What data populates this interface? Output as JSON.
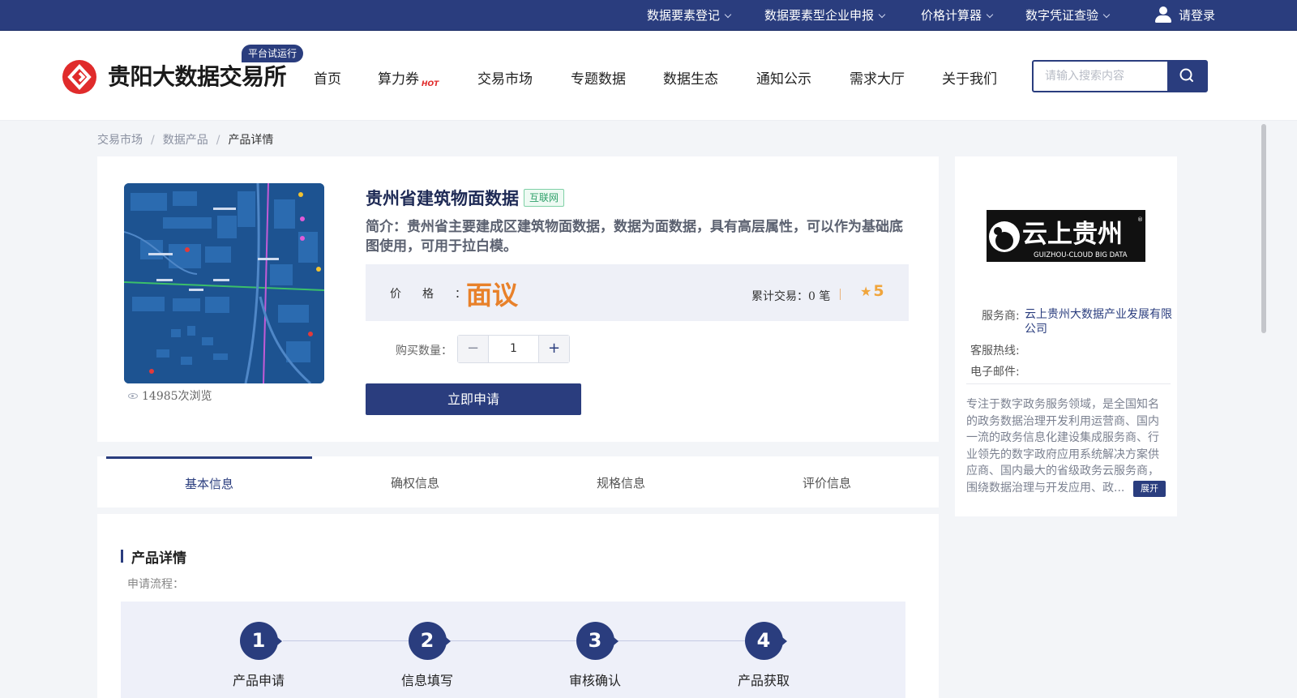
{
  "topbar": {
    "items": [
      {
        "label": "数据要素登记"
      },
      {
        "label": "数据要素型企业申报"
      },
      {
        "label": "价格计算器"
      },
      {
        "label": "数字凭证查验"
      }
    ],
    "login": "请登录"
  },
  "header": {
    "site_name": "贵阳大数据交易所",
    "badge": "平台试运行",
    "nav": [
      "首页",
      "算力券",
      "交易市场",
      "专题数据",
      "数据生态",
      "通知公示",
      "需求大厅",
      "关于我们"
    ],
    "hot_label": "HOT",
    "search_placeholder": "请输入搜索内容"
  },
  "breadcrumb": [
    "交易市场",
    "数据产品",
    "产品详情"
  ],
  "product": {
    "title": "贵州省建筑物面数据",
    "tag": "互联网",
    "description": "简介：贵州省主要建成区建筑物面数据，数据为面数据，具有高层属性，可以作为基础底图使用，可用于拉白模。",
    "price_label": "价格：",
    "price_value": "面议",
    "trades": "累计交易：0 笔",
    "rating": "5",
    "views": "14985次浏览",
    "quantity_label": "购买数量：",
    "quantity": "1",
    "apply_label": "立即申请"
  },
  "tabs": [
    "基本信息",
    "确权信息",
    "规格信息",
    "评价信息"
  ],
  "details": {
    "title": "产品详情",
    "subtitle": "申请流程：",
    "steps": [
      {
        "num": "1",
        "label": "产品申请"
      },
      {
        "num": "2",
        "label": "信息填写"
      },
      {
        "num": "3",
        "label": "审核确认"
      },
      {
        "num": "4",
        "label": "产品获取"
      }
    ]
  },
  "provider": {
    "logo_text": "云上贵州",
    "logo_sub": "GUIZHOU-CLOUD  BIG  DATA",
    "service_label": "服务商:",
    "service_value_line1": "云上贵州大数据产业发展有限",
    "service_value_line2": "公司",
    "hotline_label": "客服热线:",
    "email_label": "电子邮件:",
    "intro": "专注于数字政务服务领域，是全国知名的政务数据治理开发利用运营商、国内一流的政务信息化建设集成服务商、行业领先的数字政府应用系统解决方案供应商、国内最大的省级政务云服务商，围绕数据治理与开发应用、政...",
    "expand_label": "展开"
  },
  "colors": {
    "primary": "#2a3d7e",
    "accent": "#e8812a",
    "logo_red": "#e02b2b",
    "tag_green": "#2fa06a"
  }
}
